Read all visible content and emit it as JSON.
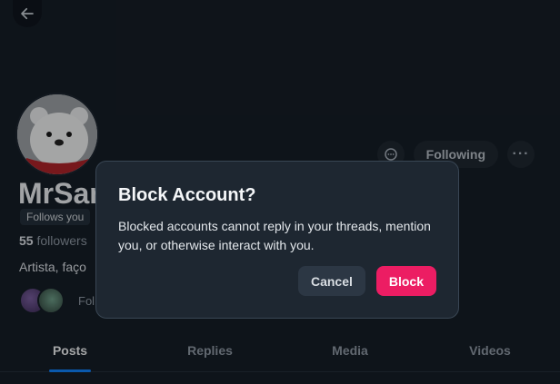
{
  "profile": {
    "display_name": "MrSam",
    "follows_you_badge": "Follows you",
    "followers_count": "55",
    "followers_label": "followers",
    "bio": "Artista, faço",
    "known_followers_text": "Fol",
    "following_button": "Following",
    "more_button": "···"
  },
  "tabs": [
    {
      "label": "Posts",
      "active": true
    },
    {
      "label": "Replies",
      "active": false
    },
    {
      "label": "Media",
      "active": false
    },
    {
      "label": "Videos",
      "active": false
    }
  ],
  "dialog": {
    "title": "Block Account?",
    "message": "Blocked accounts cannot reply in your threads, mention you, or otherwise interact with you.",
    "cancel_label": "Cancel",
    "confirm_label": "Block"
  },
  "colors": {
    "background": "#161e27",
    "dialog_bg": "#1e2731",
    "accent_tab": "#1083fe",
    "block_button": "#ec1d63"
  },
  "icons": {
    "back": "arrow-left-icon",
    "message": "chat-bubble-icon",
    "more": "ellipsis-icon"
  }
}
